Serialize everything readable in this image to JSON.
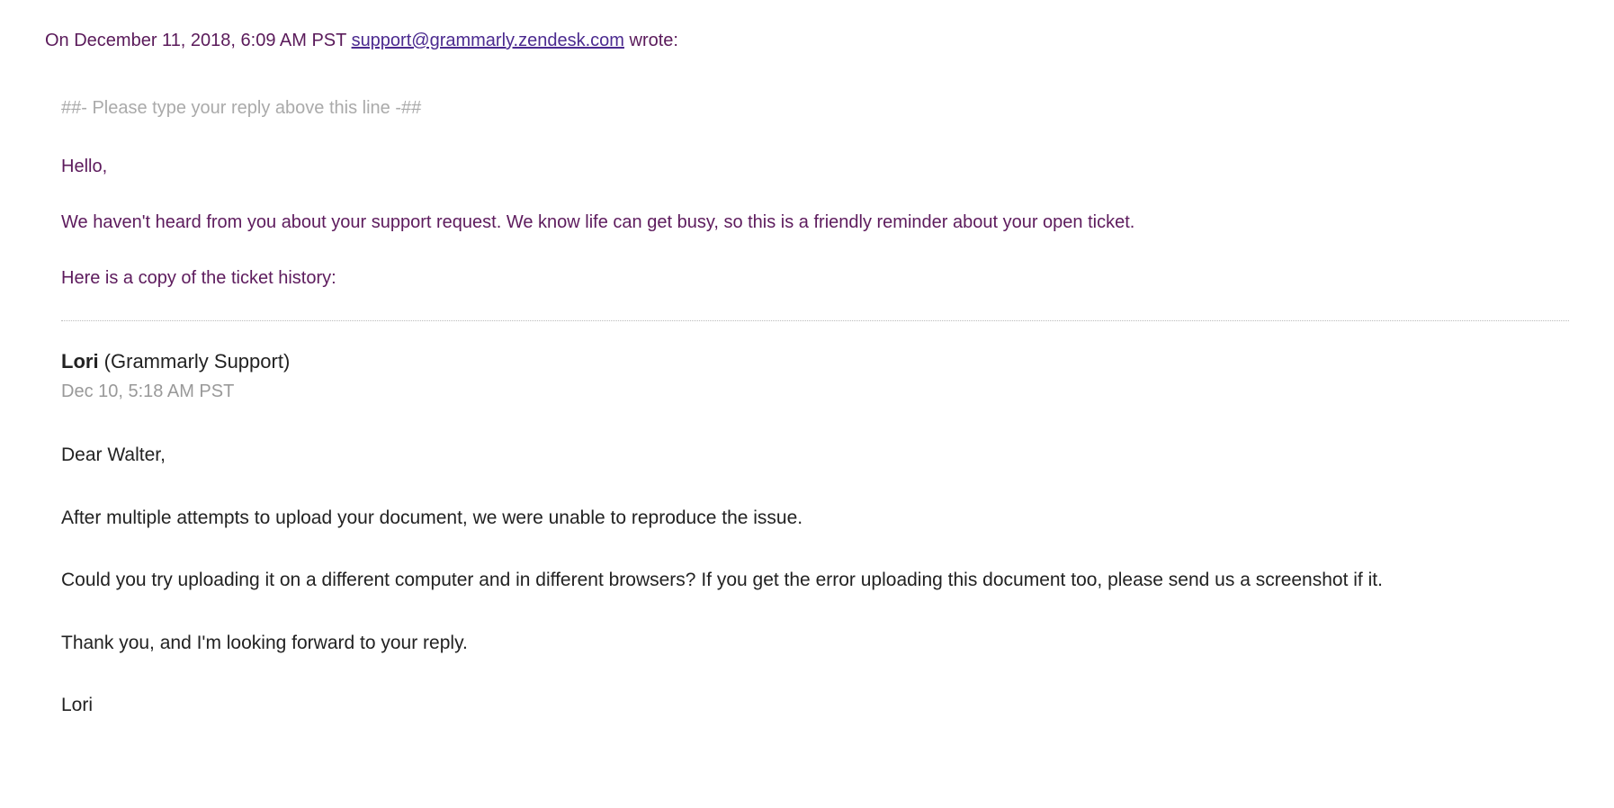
{
  "header": {
    "prefix": "On December 11, 2018, 6:09 AM PST ",
    "email": "support@grammarly.zendesk.com",
    "suffix": " wrote:"
  },
  "reply_marker": "##- Please type your reply above this line -##",
  "intro": {
    "greeting": "Hello,",
    "line1": "We haven't heard from you about your support request. We know life can get busy, so this is a friendly reminder about your open ticket.",
    "line2": "Here is a copy of the ticket history:"
  },
  "history": {
    "author_name": "Lori",
    "author_org": " (Grammarly Support)",
    "timestamp": "Dec 10, 5:18 AM PST",
    "body": {
      "p1": "Dear Walter,",
      "p2": "After multiple attempts to upload your document, we were unable to reproduce the issue.",
      "p3": "Could you try uploading it on a different computer and in different browsers? If you get the error uploading this document too, please send us a screenshot if it.",
      "p4": "Thank you, and I'm looking forward to your reply.",
      "p5": "Lori"
    }
  }
}
